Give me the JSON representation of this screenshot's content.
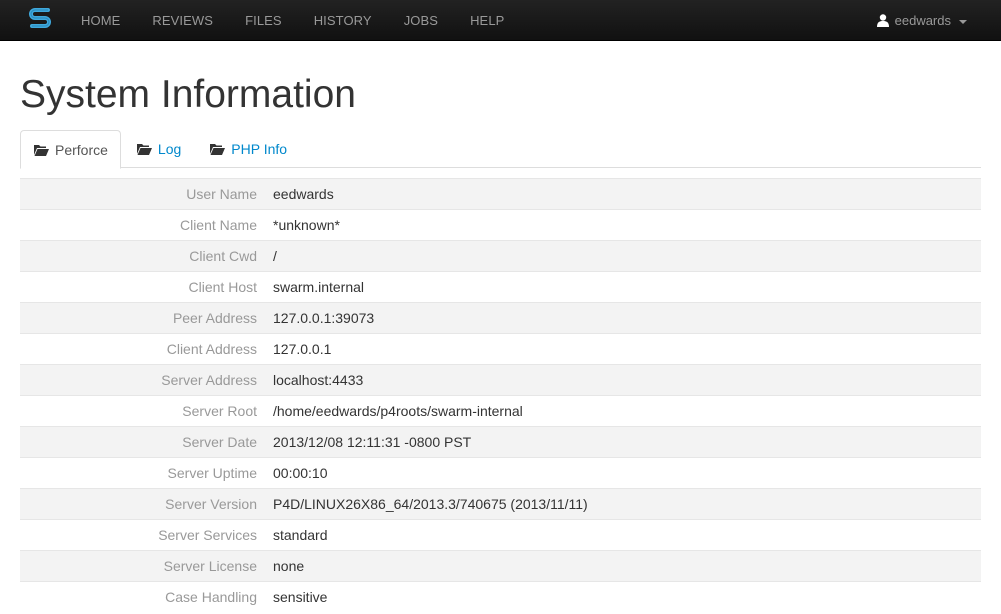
{
  "navbar": {
    "brand_icon": "swarm-logo-icon",
    "items": [
      {
        "label": "HOME"
      },
      {
        "label": "REVIEWS"
      },
      {
        "label": "FILES"
      },
      {
        "label": "HISTORY"
      },
      {
        "label": "JOBS"
      },
      {
        "label": "HELP"
      }
    ],
    "user": {
      "icon": "user-icon",
      "name": "eedwards",
      "caret_icon": "caret-down-icon"
    }
  },
  "page": {
    "title": "System Information"
  },
  "tabs": [
    {
      "label": "Perforce",
      "icon": "folder-open-icon",
      "active": true
    },
    {
      "label": "Log",
      "icon": "folder-open-icon",
      "active": false
    },
    {
      "label": "PHP Info",
      "icon": "folder-open-icon",
      "active": false
    }
  ],
  "info_rows": [
    {
      "key": "User Name",
      "value": "eedwards"
    },
    {
      "key": "Client Name",
      "value": "*unknown*"
    },
    {
      "key": "Client Cwd",
      "value": "/"
    },
    {
      "key": "Client Host",
      "value": "swarm.internal"
    },
    {
      "key": "Peer Address",
      "value": "127.0.0.1:39073"
    },
    {
      "key": "Client Address",
      "value": "127.0.0.1"
    },
    {
      "key": "Server Address",
      "value": "localhost:4433"
    },
    {
      "key": "Server Root",
      "value": "/home/eedwards/p4roots/swarm-internal"
    },
    {
      "key": "Server Date",
      "value": "2013/12/08 12:11:31 -0800 PST"
    },
    {
      "key": "Server Uptime",
      "value": "00:00:10"
    },
    {
      "key": "Server Version",
      "value": "P4D/LINUX26X86_64/2013.3/740675 (2013/11/11)"
    },
    {
      "key": "Server Services",
      "value": "standard"
    },
    {
      "key": "Server License",
      "value": "none"
    },
    {
      "key": "Case Handling",
      "value": "sensitive"
    }
  ],
  "colors": {
    "navbar_bg": "#1b1b1b",
    "brand_blue": "#3fa9dd",
    "link": "#0088cc",
    "key_text": "#999999",
    "row_stripe": "#f3f3f3"
  }
}
